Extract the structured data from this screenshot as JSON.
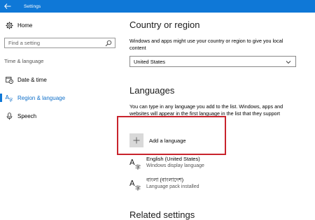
{
  "window": {
    "title": "Settings"
  },
  "sidebar": {
    "home_label": "Home",
    "search_placeholder": "Find a setting",
    "section_label": "Time & language",
    "items": [
      {
        "label": "Date & time",
        "icon": "calendar-clock-icon",
        "active": false
      },
      {
        "label": "Region & language",
        "icon": "region-language-icon",
        "active": true
      },
      {
        "label": "Speech",
        "icon": "microphone-icon",
        "active": false
      }
    ]
  },
  "main": {
    "country_heading": "Country or region",
    "country_desc": "Windows and apps might use your country or region to give you local content",
    "country_value": "United States",
    "languages_heading": "Languages",
    "languages_desc": "You can type in any language you add to the list. Windows, apps and websites will appear in the first language in the list that they support",
    "add_language_label": "Add a language",
    "languages": [
      {
        "name": "English (United States)",
        "status": "Windows display language"
      },
      {
        "name": "বাংলা (বাংলাদেশ)",
        "status": "Language pack installed"
      }
    ],
    "related_heading": "Related settings"
  },
  "colors": {
    "accent": "#0f78d7",
    "highlight_border": "#c8232c"
  }
}
